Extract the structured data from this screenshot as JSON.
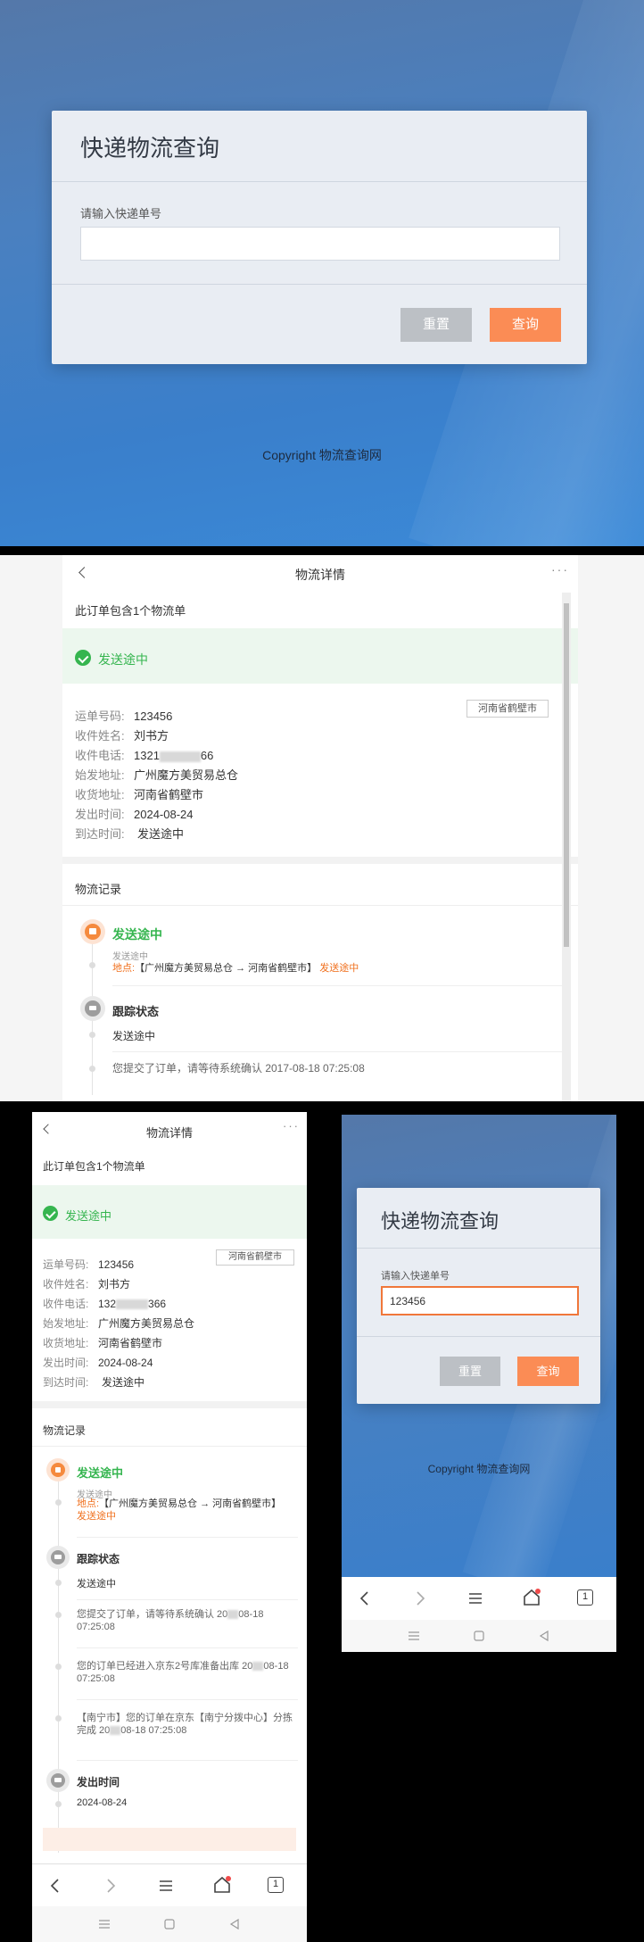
{
  "query_page": {
    "title": "快递物流查询",
    "input_label": "请输入快递单号",
    "input_value": "",
    "reset_label": "重置",
    "query_label": "查询",
    "copyright": "Copyright 物流查询网"
  },
  "detail_page": {
    "header_title": "物流详情",
    "more_icon": "···",
    "order_info": "此订单包含1个物流单",
    "status": "发送途中",
    "tag": "河南省鹤壁市",
    "fields": [
      {
        "label": "运单号码:",
        "value": "123456"
      },
      {
        "label": "收件姓名:",
        "value": "刘书方"
      },
      {
        "label": "收件电话:",
        "value_prefix": "1321",
        "value_suffix": "66"
      },
      {
        "label": "始发地址:",
        "value": "广州魔方美贸易总仓"
      },
      {
        "label": "收货地址:",
        "value": "河南省鹤壁市"
      },
      {
        "label": "发出时间:",
        "value": "2024-08-24"
      },
      {
        "label": "到达时间:",
        "value": "发送途中"
      }
    ],
    "records_title": "物流记录",
    "timeline": {
      "sending_title": "发送途中",
      "sending_sub": "发送途中",
      "location_label": "地点:",
      "location_route": "【广州魔方美贸易总仓 → 河南省鹤壁市】",
      "location_status": "发送途中",
      "tracking_title": "跟踪状态",
      "tracking_sub": "发送途中",
      "entry1_full": "您提交了订单，请等待系统确认 2017-08-18 07:25:08",
      "entry1_a": "您提交了订单，请等待系统确认 20",
      "entry1_b": "08-18",
      "entry1_c": "07:25:08",
      "entry2_a": "您的订单已经进入京东2号库准备出库 20",
      "entry2_b": "08-18",
      "entry2_c": "07:25:08",
      "entry3_a": "【南宁市】您的订单在京东【南宁分拨中心】分拣",
      "entry3_b": "完成 20",
      "entry3_c": "08-18 07:25:08",
      "sent_time_title": "发出时间",
      "sent_time_value": "2024-08-24"
    },
    "phone_prefix_short": "132",
    "phone_suffix_short": "366"
  },
  "phone_query_page": {
    "title": "快递物流查询",
    "input_label": "请输入快递单号",
    "input_value": "123456",
    "reset_label": "重置",
    "query_label": "查询",
    "copyright": "Copyright 物流查询网"
  },
  "browser_nav": {
    "tabs_count": "1"
  },
  "colors": {
    "accent_orange": "#fb8c55",
    "status_green": "#35b54f",
    "button_gray": "#bcc0c5"
  }
}
